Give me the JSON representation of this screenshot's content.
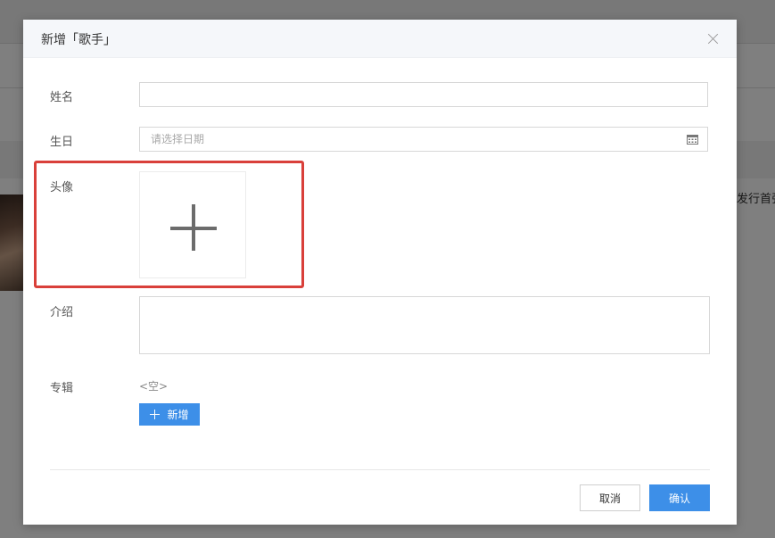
{
  "background": {
    "truncated_text": "发行首张"
  },
  "modal": {
    "title": "新增「歌手」",
    "fields": {
      "name_label": "姓名",
      "birthday_label": "生日",
      "birthday_placeholder": "请选择日期",
      "avatar_label": "头像",
      "intro_label": "介绍",
      "album_label": "专辑",
      "album_empty_text": "<空>",
      "album_add_label": "新增"
    },
    "footer": {
      "cancel_label": "取消",
      "confirm_label": "确认"
    }
  },
  "icons": {
    "close": "close-icon",
    "calendar": "calendar-icon",
    "upload": "plus-icon",
    "add": "plus-icon"
  },
  "colors": {
    "primary": "#3d8fe8",
    "highlight": "#d9403a"
  }
}
